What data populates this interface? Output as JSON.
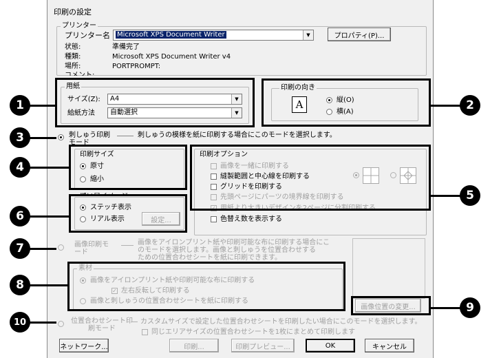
{
  "dialog": {
    "title": "印刷の設定"
  },
  "printer": {
    "legend": "プリンター",
    "name_label": "プリンター名",
    "name_value": "Microsoft XPS Document Writer",
    "properties_button": "プロパティ(P)...",
    "status_label": "状態:",
    "status_value": "準備完了",
    "type_label": "種類:",
    "type_value": "Microsoft XPS Document Writer v4",
    "location_label": "場所:",
    "location_value": "PORTPROMPT:",
    "comment_label": "コメント:"
  },
  "paper": {
    "legend": "用紙",
    "size_label": "サイズ(Z):",
    "size_value": "A4",
    "source_label": "給紙方法",
    "source_value": "自動選択"
  },
  "orientation": {
    "legend": "印刷の向き",
    "icon_letter": "A",
    "portrait": "縦(O)",
    "landscape": "横(A)"
  },
  "modes": {
    "embroidery_mode": "刺しゅう印刷モード",
    "embroidery_desc": "刺しゅうの模様を紙に印刷する場合にこのモードを選択します。",
    "image_mode": "画像印刷モード",
    "image_desc": [
      "画像をアイロンプリント紙や印刷可能な布に印刷する場合にこ",
      "のモードを選択します。画像と刺しゅうを位置合わせする",
      "ための位置合わせシートを紙に印刷できます。"
    ],
    "align_mode": "位置合わせシート印刷モード",
    "align_desc": "カスタムサイズで設定した位置合わせシートを印刷したい場合にこのモードを選択します。",
    "align_checkbox": "同じエリアサイズの位置合わせシートを1枚にまとめて印刷します"
  },
  "print_size": {
    "legend": "印刷サイズ",
    "actual": "原寸",
    "reduced": "縮小"
  },
  "stitch": {
    "legend": "縫い目イメージ",
    "stitch_view": "ステッチ表示",
    "real_view": "リアル表示",
    "settings_button": "設定..."
  },
  "options": {
    "legend": "印刷オプション",
    "items": [
      {
        "label": "画像を一緒に印刷する",
        "checked": false,
        "enabled": false
      },
      {
        "label": "縫製範囲と中心線を印刷する",
        "checked": false,
        "enabled": true
      },
      {
        "label": "グリッドを印刷する",
        "checked": false,
        "enabled": true
      },
      {
        "label": "先頭ページにパーツの境界線を印刷する",
        "checked": false,
        "enabled": false
      },
      {
        "label": "用紙より大きいデザインを2ページに分割印刷する",
        "checked": true,
        "enabled": false
      },
      {
        "label": "色替え数を表示する",
        "checked": false,
        "enabled": true
      }
    ]
  },
  "material": {
    "legend": "素材",
    "iron_print": "画像をアイロンプリント紙や印刷可能な布に印刷する",
    "mirror": "左右反転して印刷する",
    "align_print": "画像と刺しゅうの位置合わせシートを紙に印刷する"
  },
  "buttons": {
    "change_image_position": "画像位置の変更...",
    "network": "ネットワーク...",
    "print": "印刷...",
    "print_preview": "印刷プレビュー...",
    "ok": "OK",
    "cancel": "キャンセル"
  },
  "callouts": [
    "1",
    "2",
    "3",
    "4",
    "5",
    "6",
    "7",
    "8",
    "9",
    "10"
  ]
}
